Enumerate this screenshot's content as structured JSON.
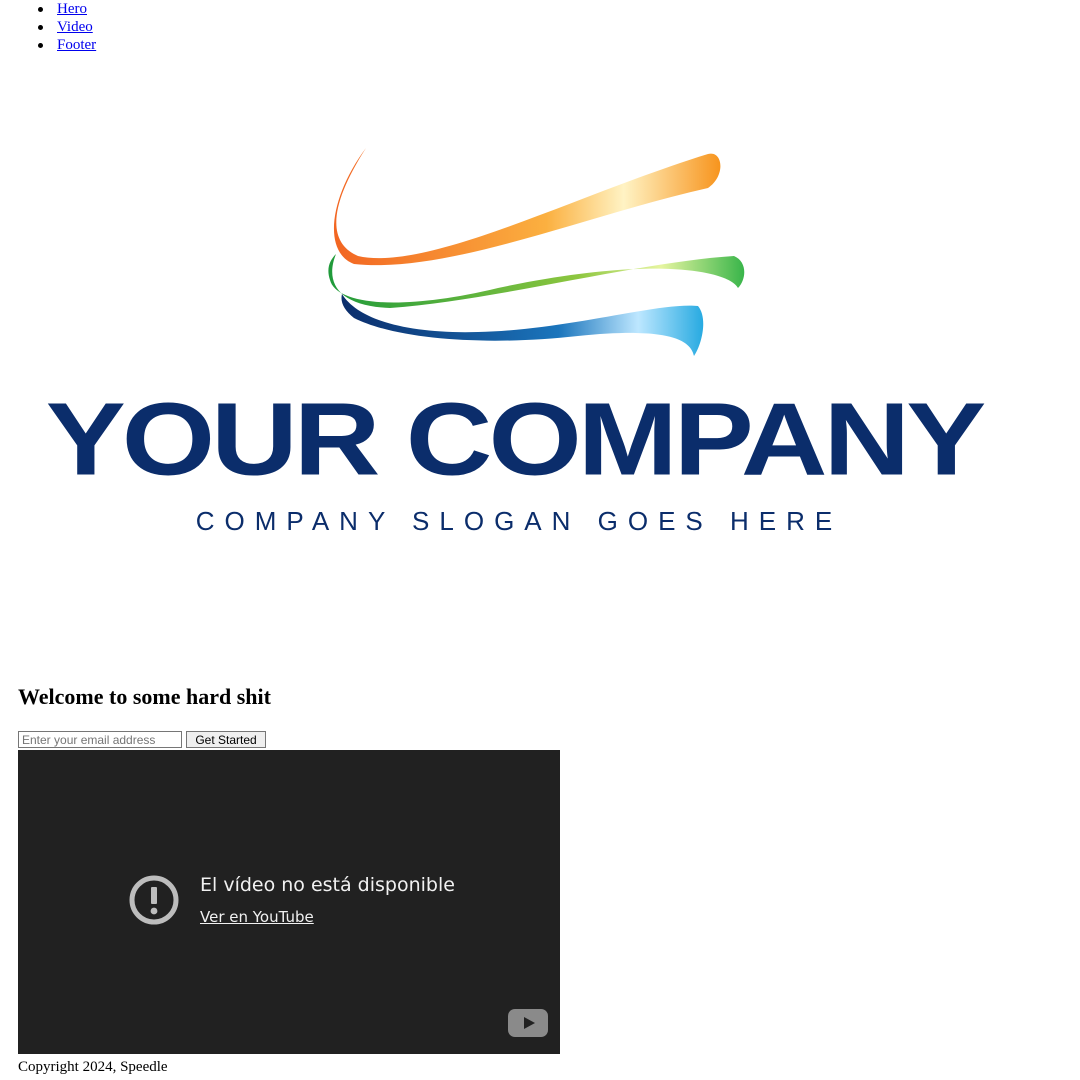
{
  "nav": {
    "items": [
      {
        "label": "Hero"
      },
      {
        "label": "Video"
      },
      {
        "label": "Footer"
      }
    ]
  },
  "hero": {
    "logo": {
      "company_name": "YOUR COMPANY",
      "slogan": "COMPANY SLOGAN GOES HERE",
      "colors": {
        "orange": "#f7941d",
        "green": "#39b54a",
        "blue": "#1b75bc",
        "navy": "#0b2d6b"
      }
    },
    "title": "Welcome to some hard shit",
    "email_placeholder": "Enter your email address",
    "cta_label": "Get Started"
  },
  "video": {
    "message": "El vídeo no está disponible",
    "link_label": "Ver en YouTube"
  },
  "footer": {
    "copyright": "Copyright 2024, Speedle"
  }
}
